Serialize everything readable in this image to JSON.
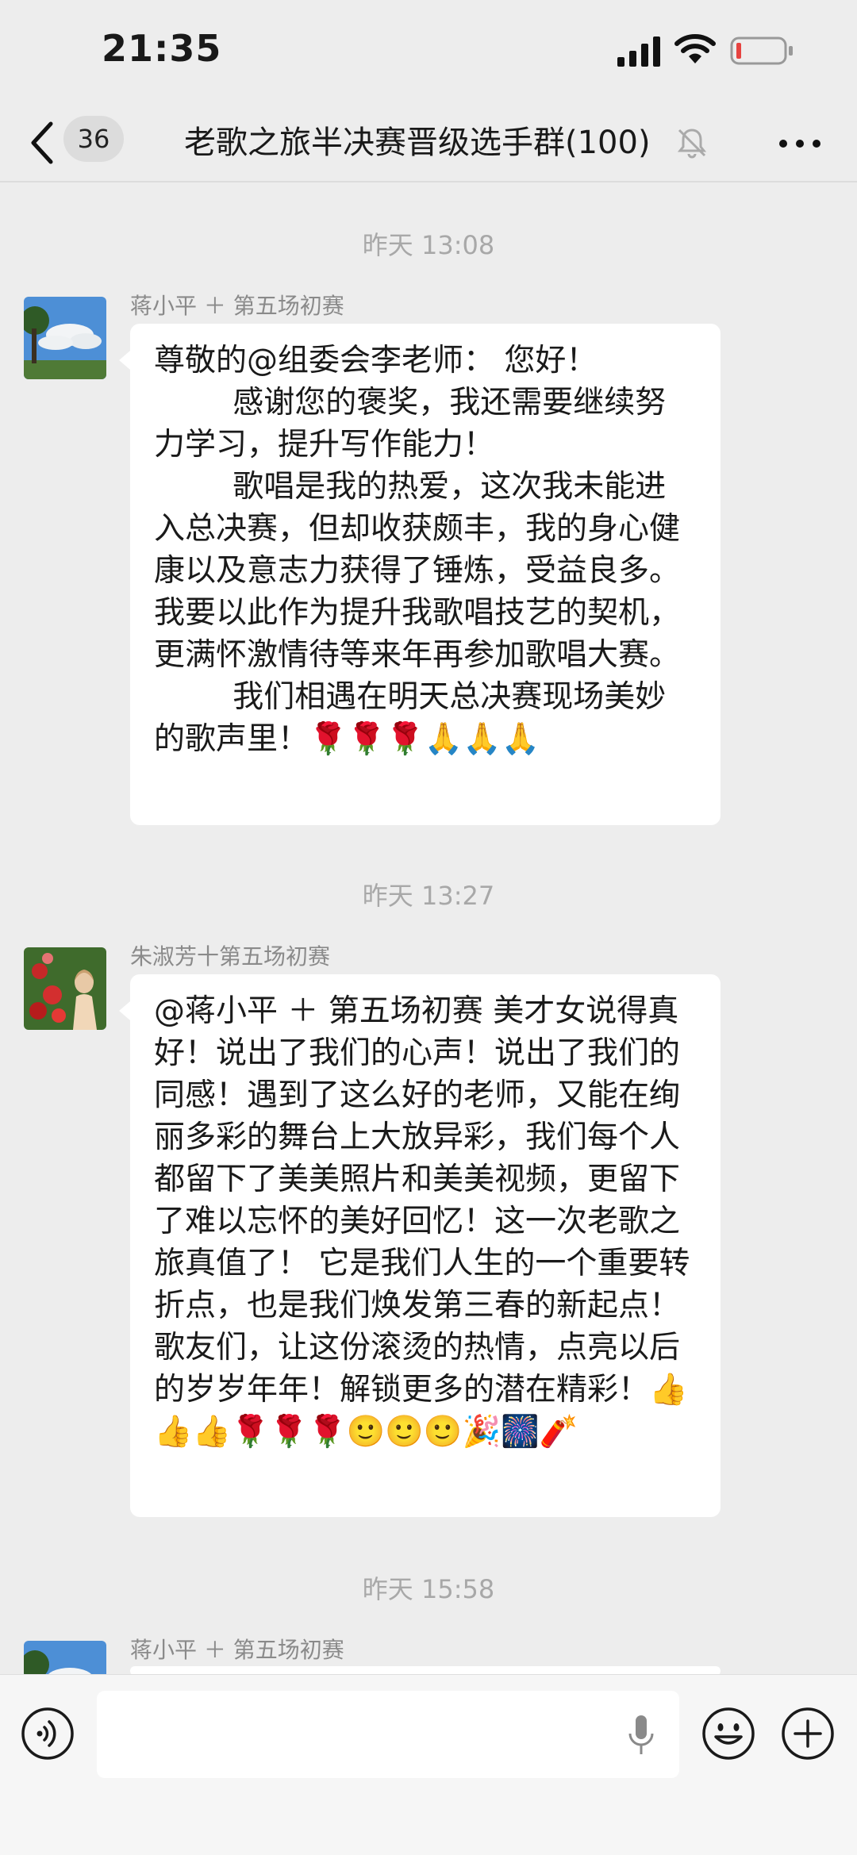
{
  "status_bar": {
    "time": "21:35",
    "icons": [
      "signal-icon",
      "wifi-icon",
      "battery-low-icon"
    ],
    "battery_color": "#e64340"
  },
  "nav": {
    "back_icon": "chevron-left-icon",
    "unread_count": "36",
    "title": "老歌之旅半决赛晋级选手群(100)",
    "mute_icon": "bell-muted-icon",
    "more_icon": "more-dots-icon"
  },
  "messages": [
    {
      "timestamp": "昨天 13:08",
      "sender": "蒋小平 ＋ 第五场初赛",
      "avatar": "landscape-sky-avatar",
      "text": "尊敬的@组委会李老师： 您好！\n        感谢您的褒奖，我还需要继续努力学习，提升写作能力！\n        歌唱是我的热爱，这次我未能进入总决赛，但却收获颇丰，我的身心健康以及意志力获得了锤炼，受益良多。我要以此作为提升我歌唱技艺的契机，更满怀激情待等来年再参加歌唱大赛。\n        我们相遇在明天总决赛现场美妙的歌声里！🌹🌹🌹🙏🙏🙏"
    },
    {
      "timestamp": "昨天 13:27",
      "sender": "朱淑芳十第五场初赛",
      "avatar": "flowers-portrait-avatar",
      "text": "@蒋小平 ＋ 第五场初赛 美才女说得真好！说出了我们的心声！说出了我们的同感！遇到了这么好的老师，又能在绚丽多彩的舞台上大放异彩，我们每个人都留下了美美照片和美美视频，更留下了难以忘怀的美好回忆！这一次老歌之旅真值了！ 它是我们人生的一个重要转折点，也是我们焕发第三春的新起点！歌友们，让这份滚烫的热情，点亮以后的岁岁年年！解锁更多的潜在精彩！👍👍👍🌹🌹🌹🙂🙂🙂🎉🎆🧨"
    },
    {
      "timestamp": "昨天 15:58",
      "sender": "蒋小平 ＋ 第五场初赛",
      "avatar": "landscape-sky-avatar",
      "text": ""
    }
  ],
  "input_bar": {
    "voice_icon": "voice-mode-icon",
    "mic_icon": "microphone-icon",
    "emoji_icon": "emoji-icon",
    "plus_icon": "plus-circle-icon"
  }
}
